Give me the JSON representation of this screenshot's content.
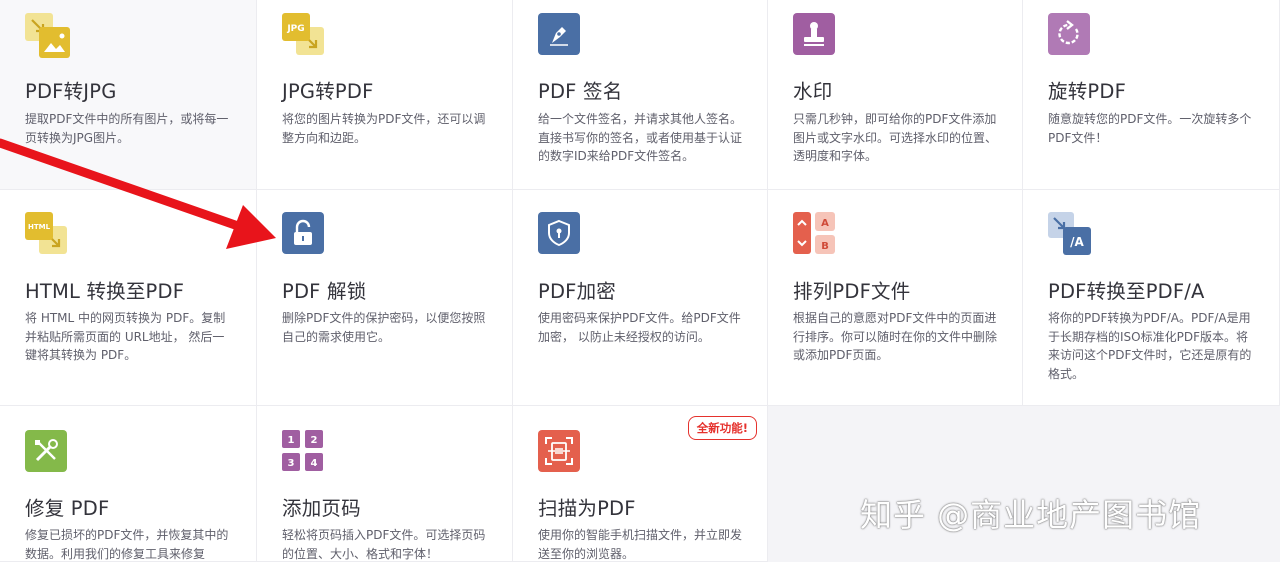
{
  "tools": [
    {
      "title": "PDF转JPG",
      "desc": "提取PDF文件中的所有图片，或将每一页转换为JPG图片。",
      "icon": "pdf-to-jpg-icon"
    },
    {
      "title": "JPG转PDF",
      "desc": "将您的图片转换为PDF文件，还可以调整方向和边距。",
      "icon": "jpg-to-pdf-icon",
      "icon_text": "JPG"
    },
    {
      "title": "PDF 签名",
      "desc": "给一个文件签名，并请求其他人签名。直接书写你的签名，或者使用基于认证的数字ID来给PDF文件签名。",
      "icon": "sign-pen-icon"
    },
    {
      "title": "水印",
      "desc": "只需几秒钟，即可给你的PDF文件添加图片或文字水印。可选择水印的位置、透明度和字体。",
      "icon": "watermark-stamp-icon"
    },
    {
      "title": "旋转PDF",
      "desc": "随意旋转您的PDF文件。一次旋转多个PDF文件！",
      "icon": "rotate-icon"
    },
    {
      "title": "HTML 转换至PDF",
      "desc": "将 HTML 中的网页转换为 PDF。复制并粘贴所需页面的 URL地址， 然后一键将其转换为 PDF。",
      "icon": "html-to-pdf-icon",
      "icon_text": "HTML"
    },
    {
      "title": "PDF 解锁",
      "desc": "删除PDF文件的保护密码，以便您按照自己的需求使用它。",
      "icon": "unlock-icon"
    },
    {
      "title": "PDF加密",
      "desc": "使用密码来保护PDF文件。给PDF文件加密， 以防止未经授权的访问。",
      "icon": "protect-shield-icon"
    },
    {
      "title": "排列PDF文件",
      "desc": "根据自己的意愿对PDF文件中的页面进行排序。你可以随时在你的文件中删除或添加PDF页面。",
      "icon": "organize-icon",
      "icon_text_a": "A",
      "icon_text_b": "B"
    },
    {
      "title": "PDF转换至PDF/A",
      "desc": "将你的PDF转换为PDF/A。PDF/A是用于长期存档的ISO标准化PDF版本。将来访问这个PDF文件时，它还是原有的格式。",
      "icon": "pdf-to-pdfa-icon",
      "icon_text": "/A"
    },
    {
      "title": "修复 PDF",
      "desc": "修复已损坏的PDF文件，并恢复其中的数据。利用我们的修复工具来修复",
      "icon": "repair-tools-icon"
    },
    {
      "title": "添加页码",
      "desc": "轻松将页码插入PDF文件。可选择页码的位置、大小、格式和字体！",
      "icon": "page-numbers-icon",
      "icon_nums": [
        "1",
        "2",
        "3",
        "4"
      ]
    },
    {
      "title": "扫描为PDF",
      "desc": "使用你的智能手机扫描文件，并立即发送至你的浏览器。",
      "icon": "scan-icon",
      "badge": "全新功能!"
    }
  ],
  "watermark": "知乎 @商业地产图书馆",
  "colors": {
    "yellow": "#e9c73a",
    "blue": "#4a6fa5",
    "purple": "#a05ea1",
    "red": "#e4604d",
    "green": "#84b94a"
  }
}
